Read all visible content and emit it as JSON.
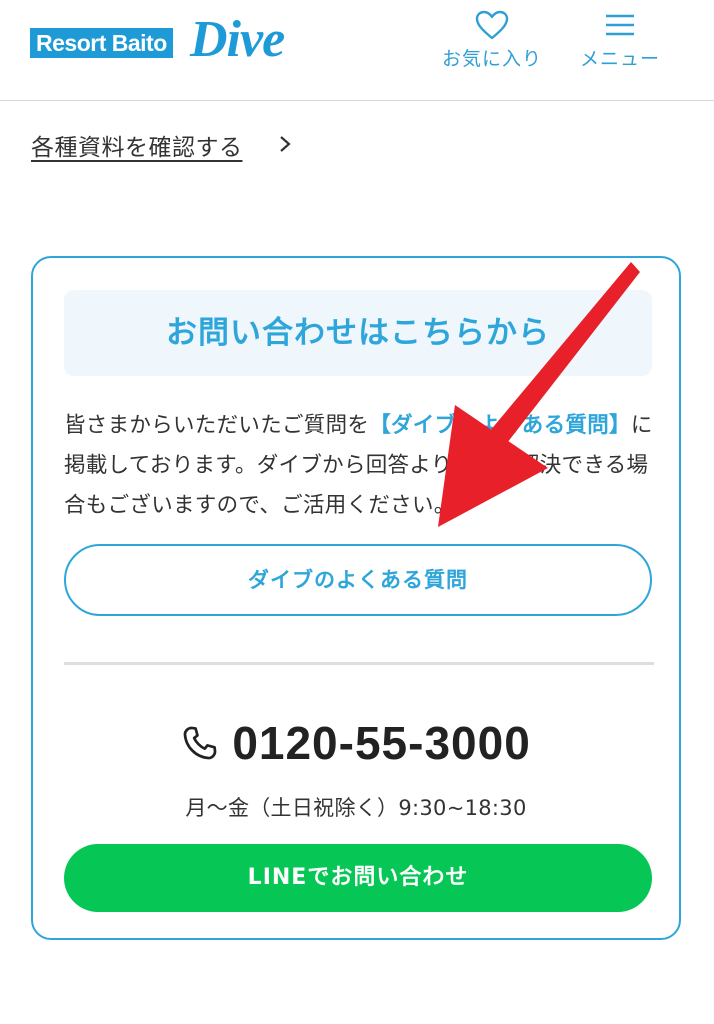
{
  "header": {
    "logo_text": "Resort Baito",
    "logo_script": "Dive",
    "favorite_label": "お気に入り",
    "menu_label": "メニュー"
  },
  "docs": {
    "link_label": "各種資料を確認する"
  },
  "contact": {
    "title": "お問い合わせはこちらから",
    "desc_before": " 皆さまからいただいたご質問を",
    "desc_highlight": "【ダイブのよくある質問】",
    "desc_after": "に掲載しております。ダイブから回答よりも早く解決できる場合もございますので、ご活用ください。",
    "faq_button": "ダイブのよくある質問",
    "phone_number": "0120-55-3000",
    "hours": "月～金（土日祝除く）9:30~18:30",
    "line_button": "LINEでお問い合わせ"
  },
  "colors": {
    "brand": "#1e9bd7",
    "accent": "#2ea6da",
    "line_green": "#06c755",
    "annotation_arrow": "#e8202a"
  },
  "icons": [
    "heart-icon",
    "hamburger-menu-icon",
    "chevron-right-icon",
    "phone-icon"
  ]
}
